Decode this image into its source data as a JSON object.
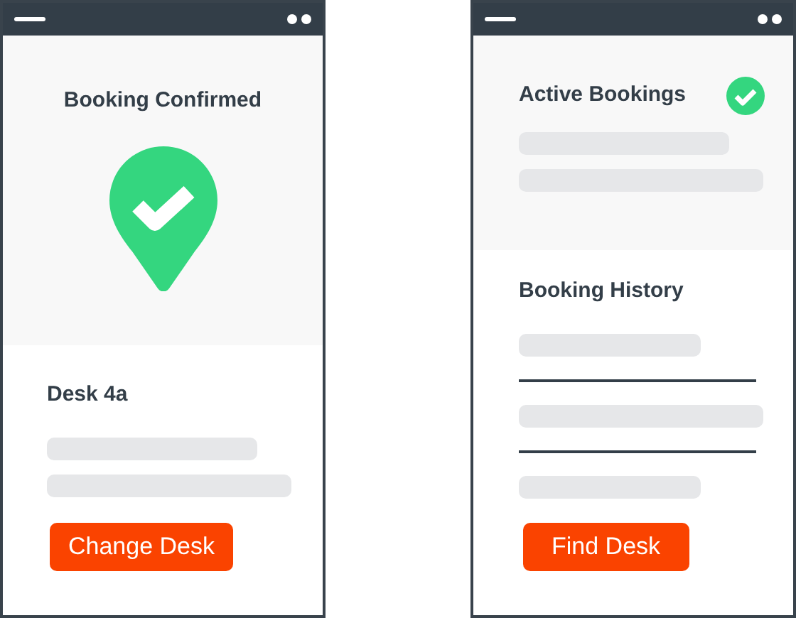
{
  "screens": [
    {
      "kind": "confirmation",
      "hero": {
        "title": "Booking Confirmed"
      },
      "section": {
        "title": "Desk 4a",
        "skeleton_rows": [
          {
            "kind": "short"
          },
          {
            "kind": "long"
          }
        ]
      },
      "button": "Change Desk"
    },
    {
      "kind": "bookings",
      "hero": {
        "title": "Active Bookings",
        "skeleton_rows": [
          {
            "kind": "short"
          },
          {
            "kind": "long"
          }
        ]
      },
      "section": {
        "title": "Booking History",
        "skeleton_rows": [
          {
            "kind": "medium"
          },
          {
            "kind": "divider"
          },
          {
            "kind": "long"
          },
          {
            "kind": "divider"
          },
          {
            "kind": "medium"
          }
        ]
      },
      "button": "Find Desk"
    }
  ]
}
